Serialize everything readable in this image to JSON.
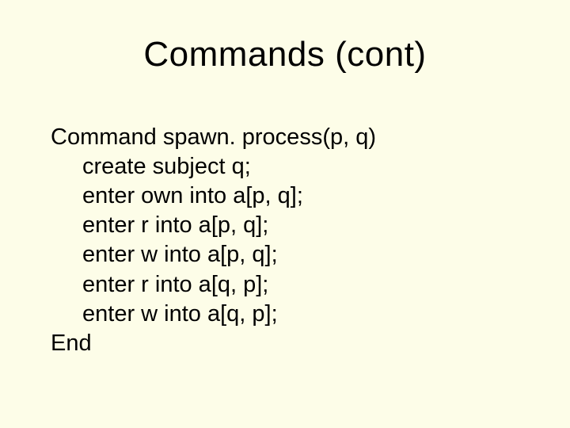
{
  "title": "Commands (cont)",
  "body": {
    "line1": "Command spawn. process(p, q)",
    "line2": "create subject q;",
    "line3": "enter own into a[p, q];",
    "line4": "enter r into a[p, q];",
    "line5": "enter w into a[p, q];",
    "line6": "enter r into a[q, p];",
    "line7": "enter w into a[q, p];",
    "line8": "End"
  }
}
